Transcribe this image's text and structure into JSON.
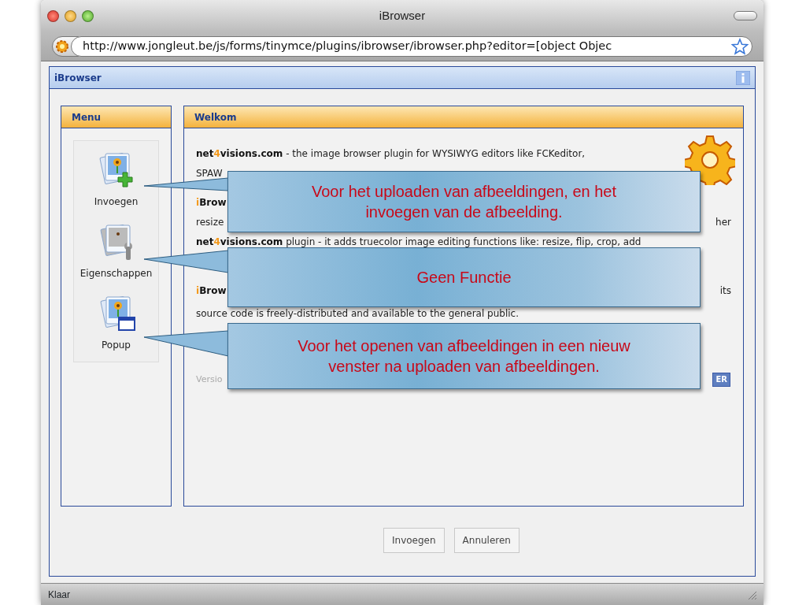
{
  "window": {
    "title": "iBrowser"
  },
  "address_bar": {
    "url": "http://www.jongleut.be/js/forms/tinymce/plugins/ibrowser/ibrowser.php?editor=[object Objec"
  },
  "dialog": {
    "title": "iBrowser"
  },
  "menu": {
    "title": "Menu",
    "items": [
      {
        "label": "Invoegen",
        "kind": "insert"
      },
      {
        "label": "Eigenschappen",
        "kind": "properties"
      },
      {
        "label": "Popup",
        "kind": "popup"
      }
    ]
  },
  "welcome": {
    "title": "Welkom",
    "paragraphs": [
      [
        {
          "left": [
            {
              "text": "net",
              "kind": "bold"
            },
            {
              "text": "4",
              "kind": "accent"
            },
            {
              "text": "visions.com",
              "kind": "bold"
            },
            {
              "text": " - the image browser plugin for WYSIWYG editors like FCKeditor,",
              "kind": "plain"
            }
          ]
        },
        {
          "left": [
            {
              "text": "SPAW",
              "kind": "plain"
            }
          ]
        }
      ],
      [
        {
          "left": [
            {
              "text": "i",
              "kind": "accent"
            },
            {
              "text": "Brow",
              "kind": "bold"
            }
          ]
        },
        {
          "left": [
            {
              "text": "resize",
              "kind": "plain"
            }
          ],
          "right": "her"
        },
        {
          "left": [
            {
              "text": "net",
              "kind": "bold"
            },
            {
              "text": "4",
              "kind": "accent"
            },
            {
              "text": "visions.com",
              "kind": "bold"
            },
            {
              "text": " plugin - it adds truecolor image editing functions like: resize, flip, crop, add",
              "kind": "plain"
            }
          ]
        }
      ],
      [
        {
          "left": [
            {
              "text": "i",
              "kind": "accent"
            },
            {
              "text": "Brow",
              "kind": "bold"
            }
          ],
          "right": "its"
        },
        {
          "left": [
            {
              "text": "source code is freely-distributed and available to the general public.",
              "kind": "plain"
            }
          ]
        }
      ]
    ],
    "version": {
      "text": "Versio",
      "button": "ER"
    }
  },
  "buttons": [
    "Invoegen",
    "Annuleren"
  ],
  "status_bar": "Klaar",
  "callouts": [
    {
      "text": "Voor het uploaden van afbeeldingen, en het invoegen van de afbeelding."
    },
    {
      "text": "Geen Functie"
    },
    {
      "text": "Voor het openen van afbeeldingen in een nieuw venster na uploaden van afbeeldingen."
    }
  ]
}
